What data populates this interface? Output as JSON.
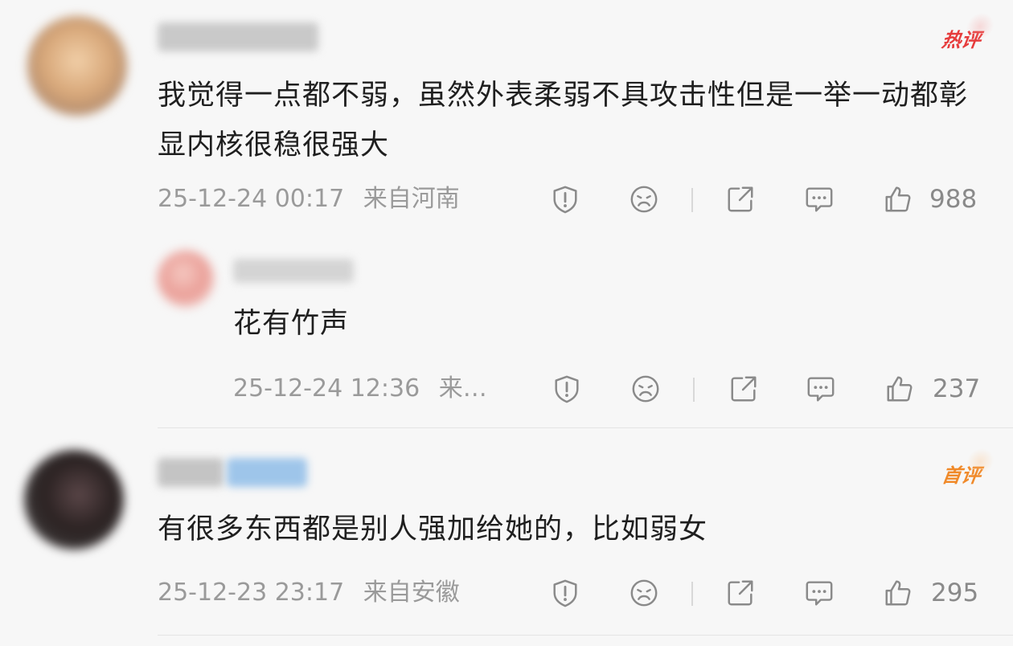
{
  "comments": [
    {
      "text": "我觉得一点都不弱，虽然外表柔弱不具攻击性但是一举一动都彰显内核很稳很强大",
      "time": "25-12-24 00:17",
      "location": "来自河南",
      "likes": "988",
      "badge": "热评"
    },
    {
      "text": "花有竹声",
      "time": "25-12-24 12:36",
      "location": "来…",
      "likes": "237"
    },
    {
      "text": "有很多东西都是别人强加给她的，比如弱女",
      "time": "25-12-23 23:17",
      "location": "来自安徽",
      "likes": "295",
      "badge": "首评"
    }
  ],
  "icons": {
    "report": "report-icon",
    "dislike": "dislike-face-icon",
    "share": "share-icon",
    "reply": "comment-icon",
    "like": "thumbs-up-icon"
  },
  "colors": {
    "hot_badge": "#e63c3c",
    "first_badge": "#f08a2a",
    "meta_text": "#9a9a9a",
    "background": "#f7f7f7"
  }
}
